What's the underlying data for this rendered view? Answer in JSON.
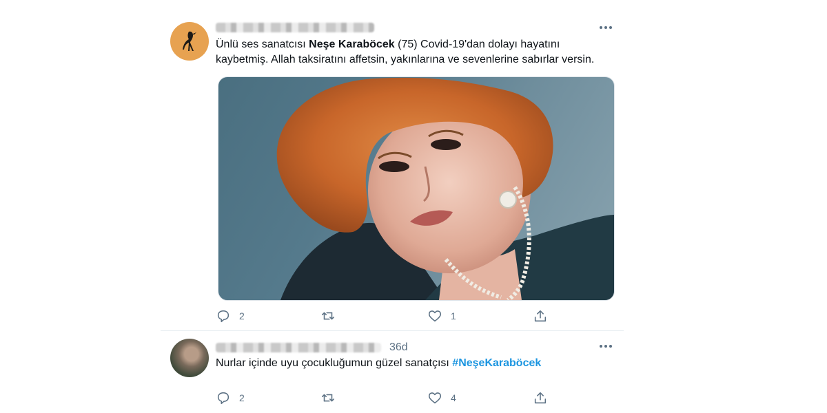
{
  "tweets": [
    {
      "text": {
        "before": "Ünlü ses sanatcısı ",
        "bold": "Neşe Karaböcek",
        "after": " (75) Covid-19'dan dolayı hayatını kaybetmiş. Allah taksiratını affetsin, yakınlarına ve sevenlerine sabırlar versin."
      },
      "actions": {
        "reply": "2",
        "retweet": "",
        "like": "1",
        "share": ""
      }
    },
    {
      "time": "36d",
      "text": {
        "before": "Nurlar içinde uyu çocukluğumun güzel sanatçısı ",
        "hashtag": "#NeşeKaraböcek"
      },
      "actions": {
        "reply": "2",
        "retweet": "",
        "like": "4",
        "share": ""
      }
    }
  ],
  "icons": {
    "reply": "reply-icon",
    "retweet": "retweet-icon",
    "like": "heart-icon",
    "share": "share-icon",
    "more": "more-icon"
  },
  "colors": {
    "hashtag": "#1b95e0",
    "muted": "#5b7083",
    "text": "#0f1419",
    "avatar1": "#e7a251"
  }
}
